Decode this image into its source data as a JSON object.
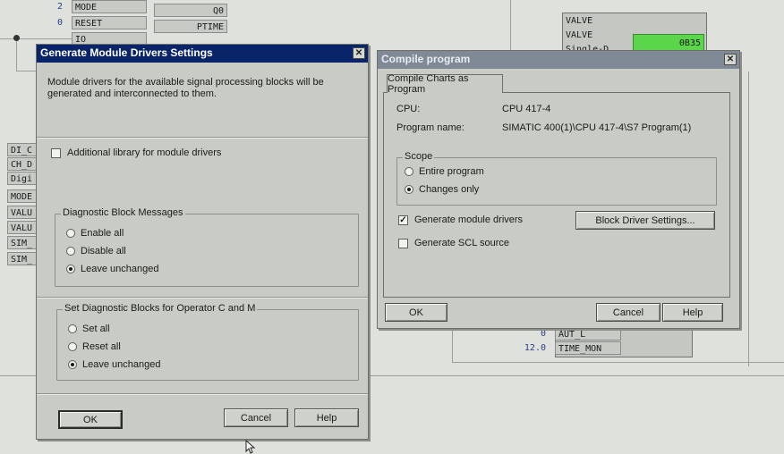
{
  "background": {
    "top_blocks": [
      "MODE",
      "RESET",
      "IO"
    ],
    "top_pin_values": [
      "2",
      "0"
    ],
    "top_right_block": [
      "Q0",
      "PTIME"
    ],
    "left_pins": [
      "DI_C",
      "CH_D",
      "Digi",
      "MODE",
      "VALU",
      "VALU",
      "SIM_",
      "SIM_"
    ],
    "valve_block": [
      "VALVE",
      "VALVE",
      "Single-D"
    ],
    "green_value": "0B35",
    "bottom_pins": [
      {
        "value": "0",
        "label": "AUT_L"
      },
      {
        "value": "12.0",
        "label": "TIME_MON"
      }
    ],
    "accent_green": "#5bd64a"
  },
  "gen_dialog": {
    "title": "Generate Module Drivers Settings",
    "description": "Module drivers for the available signal processing blocks will be generated and interconnected to them.",
    "additional_library_label": "Additional library for module drivers",
    "diag_group": {
      "label": "Diagnostic Block Messages",
      "options": [
        "Enable all",
        "Disable all",
        "Leave unchanged"
      ],
      "selected": 2
    },
    "opcm_group": {
      "label": "Set Diagnostic Blocks for Operator C and M",
      "options": [
        "Set all",
        "Reset all",
        "Leave unchanged"
      ],
      "selected": 2
    },
    "ok_label": "OK",
    "cancel_label": "Cancel",
    "help_label": "Help",
    "title_color": "#0a246a"
  },
  "compile_dialog": {
    "title": "Compile program",
    "tab_label": "Compile Charts as Program",
    "cpu_label": "CPU:",
    "cpu_value": "CPU 417-4",
    "program_label": "Program name:",
    "program_value": "SIMATIC 400(1)\\CPU 417-4\\S7 Program(1)",
    "scope_group": {
      "label": "Scope",
      "options": [
        "Entire program",
        "Changes only"
      ],
      "selected": 1
    },
    "generate_drivers_label": "Generate module drivers",
    "generate_drivers_checked": true,
    "block_driver_settings_label": "Block Driver Settings...",
    "generate_scl_label": "Generate SCL source",
    "generate_scl_checked": false,
    "ok_label": "OK",
    "cancel_label": "Cancel",
    "help_label": "Help",
    "title_color": "#7f8a96"
  }
}
